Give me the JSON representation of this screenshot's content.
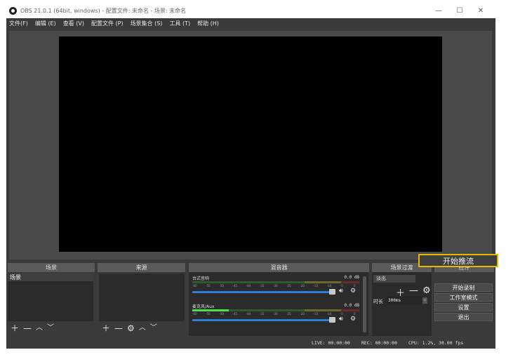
{
  "window": {
    "title": "OBS 21.0.1 (64bit, windows) - 配置文件: 未命名 - 场景: 未命名",
    "controls": [
      "—",
      "☐",
      "✕"
    ]
  },
  "menubar": {
    "items": [
      "文件(F)",
      "编辑 (E)",
      "查看 (V)",
      "配置文件 (P)",
      "场景集合 (S)",
      "工具 (T)",
      "帮助 (H)"
    ]
  },
  "docks": {
    "scenes": {
      "title": "场景",
      "items": [
        "场景"
      ]
    },
    "sources": {
      "title": "来源"
    },
    "mixer": {
      "title": "混音器",
      "channels": [
        {
          "name": "台式音响",
          "db": "0.0 dB",
          "level": 0.0
        },
        {
          "name": "麦克风/Aux",
          "db": "0.0 dB",
          "level": 0.22
        }
      ],
      "ticks": [
        "-60",
        "-55",
        "-50",
        "-45",
        "-40",
        "-35",
        "-30",
        "-25",
        "-20",
        "-15",
        "-10",
        "-5",
        "0"
      ]
    },
    "transitions": {
      "title": "场景过渡",
      "selected": "淡出",
      "duration_label": "时长",
      "duration_value": "300ms"
    },
    "controls": {
      "title": "控件",
      "start_streaming": "开始推流",
      "start_recording": "开始录制",
      "studio_mode": "工作室模式",
      "settings": "设置",
      "exit": "退出"
    }
  },
  "statusbar": {
    "live": "LIVE: 00:00:00",
    "rec": "REC: 00:00:00",
    "cpu": "CPU: 1.2%, 30.00 fps"
  },
  "colors": {
    "highlight_border": "#e6b800",
    "dock_bg": "#2b2b2b",
    "window_bg": "#3a3a3a",
    "slider": "#2f7fd6"
  }
}
